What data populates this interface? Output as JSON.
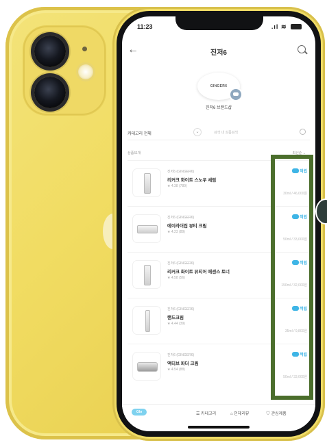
{
  "status_bar": {
    "time": "11:23",
    "signal": ".ıl",
    "wifi": "≋"
  },
  "header": {
    "back": "←",
    "title": "진저6"
  },
  "brand": {
    "logo_text": "GINGER6",
    "name": "진저6 브랜드샵"
  },
  "filter": {
    "category": "카테고리 전체",
    "chevron": "⌄",
    "search_placeholder": "검색 내 상품검색"
  },
  "sort_row": {
    "count": "상품51개",
    "sort": "최신순 ⌄"
  },
  "products": [
    {
      "brand": "진저6 (GINGER6)",
      "name": "리커크 화이트 스노우 세럼",
      "rating": "★ 4.38 (789)",
      "tag": "적립",
      "price": "30ml / 46,000원",
      "thumb": "bottle"
    },
    {
      "brand": "진저6 (GINGER6)",
      "name": "에이라더집 뷰티 크림",
      "rating": "★ 4.23 (89)",
      "tag": "적립",
      "price": "50ml / 33,000원",
      "thumb": "tube"
    },
    {
      "brand": "진저6 (GINGER6)",
      "name": "리커크 화이트 뷰티어 에센스 토너",
      "rating": "★ 4.58 (56)",
      "tag": "적립",
      "price": "150ml / 32,000원",
      "thumb": "bottle"
    },
    {
      "brand": "진저6 (GINGER6)",
      "name": "핸드크림",
      "rating": "★ 4.44 (39)",
      "tag": "적립",
      "price": "35ml / 9,800원",
      "thumb": "stick"
    },
    {
      "brand": "진저6 (GINGER6)",
      "name": "액티브 파더 크림",
      "rating": "★ 4.54 (88)",
      "tag": "적립",
      "price": "50ml / 33,000원",
      "thumb": "jar"
    }
  ],
  "bottom_bar": {
    "home": "Glo",
    "tab1": "☰ 카테고리",
    "tab2": "⌂ 인체리뷰",
    "tab3": "♡ 관심제품"
  },
  "colors": {
    "phone": "#f1dc62",
    "accent": "#3fb5e6",
    "highlight": "#4b6e2c",
    "star": "#f2b01e"
  }
}
